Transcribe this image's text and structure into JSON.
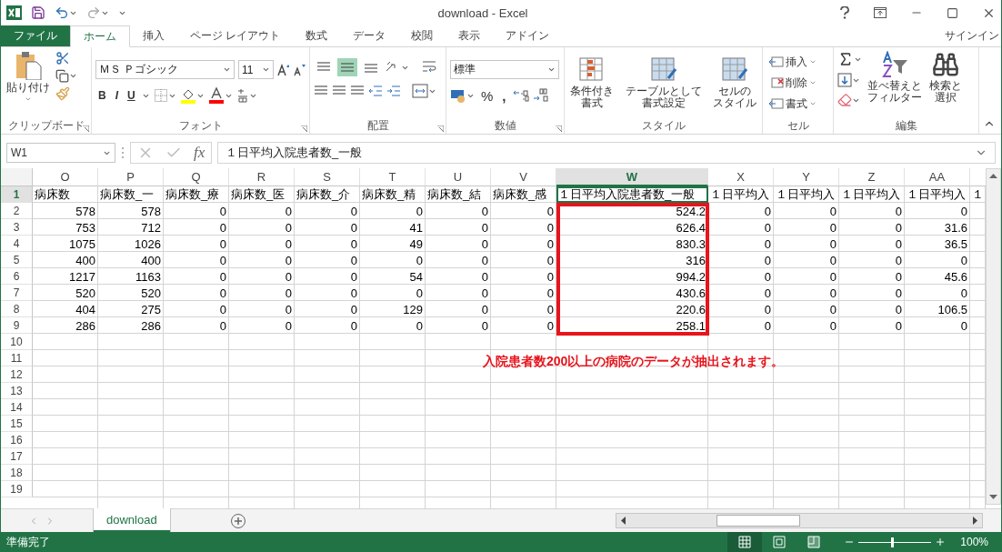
{
  "window": {
    "title": "download - Excel"
  },
  "tabs": [
    {
      "label": "ファイル",
      "kind": "file",
      "selected": false
    },
    {
      "label": "ホーム",
      "kind": "tab",
      "selected": true
    },
    {
      "label": "挿入",
      "kind": "tab",
      "selected": false
    },
    {
      "label": "ページ レイアウト",
      "kind": "tab",
      "selected": false
    },
    {
      "label": "数式",
      "kind": "tab",
      "selected": false
    },
    {
      "label": "データ",
      "kind": "tab",
      "selected": false
    },
    {
      "label": "校閲",
      "kind": "tab",
      "selected": false
    },
    {
      "label": "表示",
      "kind": "tab",
      "selected": false
    },
    {
      "label": "アドイン",
      "kind": "tab",
      "selected": false
    }
  ],
  "account": "サインイン",
  "ribbon": {
    "clipboard": {
      "name": "クリップボード",
      "paste": "貼り付け"
    },
    "font": {
      "name": "フォント",
      "font_name": "ＭＳ Ｐゴシック",
      "font_size": "11",
      "style_buttons": [
        "B",
        "I",
        "U"
      ]
    },
    "alignment": {
      "name": "配置",
      "vertical": [
        {
          "selected": false
        },
        {
          "selected": true
        },
        {
          "selected": false
        }
      ]
    },
    "number": {
      "name": "数値",
      "format": "標準",
      "buttons": [
        "%",
        ","
      ]
    },
    "styles": {
      "name": "スタイル",
      "buttons": [
        {
          "lines": [
            "条件付き",
            "書式"
          ]
        },
        {
          "lines": [
            "テーブルとして",
            "書式設定"
          ]
        },
        {
          "lines": [
            "セルの",
            "スタイル"
          ]
        }
      ]
    },
    "cells": {
      "name": "セル",
      "buttons": [
        "挿入",
        "削除",
        "書式"
      ]
    },
    "editing": {
      "name": "編集",
      "buttons": [
        {
          "lines": [
            "並べ替えと",
            "フィルター"
          ]
        },
        {
          "lines": [
            "検索と",
            "選択"
          ]
        }
      ]
    }
  },
  "formula_bar": {
    "name_box": "W1",
    "function_label": "fx",
    "value": "１日平均入院患者数_一般"
  },
  "columns": [
    {
      "label": "O",
      "selected": false
    },
    {
      "label": "P",
      "selected": false
    },
    {
      "label": "Q",
      "selected": false
    },
    {
      "label": "R",
      "selected": false
    },
    {
      "label": "S",
      "selected": false
    },
    {
      "label": "T",
      "selected": false
    },
    {
      "label": "U",
      "selected": false
    },
    {
      "label": "V",
      "selected": false
    },
    {
      "label": "W",
      "selected": true
    },
    {
      "label": "X",
      "selected": false
    },
    {
      "label": "Y",
      "selected": false
    },
    {
      "label": "Z",
      "selected": false
    },
    {
      "label": "AA",
      "selected": false
    }
  ],
  "rows": [
    {
      "number": "1",
      "selected": true,
      "kind": "header",
      "cells": [
        "病床数",
        "病床数_一",
        "病床数_療",
        "病床数_医",
        "病床数_介",
        "病床数_精",
        "病床数_結",
        "病床数_感",
        "１日平均入院患者数_一般",
        "１日平均入",
        "１日平均入",
        "１日平均入",
        "１日平均入",
        "１"
      ]
    },
    {
      "number": "2",
      "selected": false,
      "kind": "data",
      "cells": [
        "578",
        "578",
        "0",
        "0",
        "0",
        "0",
        "0",
        "0",
        "524.2",
        "0",
        "0",
        "0",
        "0"
      ]
    },
    {
      "number": "3",
      "selected": false,
      "kind": "data",
      "cells": [
        "753",
        "712",
        "0",
        "0",
        "0",
        "41",
        "0",
        "0",
        "626.4",
        "0",
        "0",
        "0",
        "31.6"
      ]
    },
    {
      "number": "4",
      "selected": false,
      "kind": "data",
      "cells": [
        "1075",
        "1026",
        "0",
        "0",
        "0",
        "49",
        "0",
        "0",
        "830.3",
        "0",
        "0",
        "0",
        "36.5"
      ]
    },
    {
      "number": "5",
      "selected": false,
      "kind": "data",
      "cells": [
        "400",
        "400",
        "0",
        "0",
        "0",
        "0",
        "0",
        "0",
        "316",
        "0",
        "0",
        "0",
        "0"
      ]
    },
    {
      "number": "6",
      "selected": false,
      "kind": "data",
      "cells": [
        "1217",
        "1163",
        "0",
        "0",
        "0",
        "54",
        "0",
        "0",
        "994.2",
        "0",
        "0",
        "0",
        "45.6"
      ]
    },
    {
      "number": "7",
      "selected": false,
      "kind": "data",
      "cells": [
        "520",
        "520",
        "0",
        "0",
        "0",
        "0",
        "0",
        "0",
        "430.6",
        "0",
        "0",
        "0",
        "0"
      ]
    },
    {
      "number": "8",
      "selected": false,
      "kind": "data",
      "cells": [
        "404",
        "275",
        "0",
        "0",
        "0",
        "129",
        "0",
        "0",
        "220.6",
        "0",
        "0",
        "0",
        "106.5"
      ]
    },
    {
      "number": "9",
      "selected": false,
      "kind": "data",
      "cells": [
        "286",
        "286",
        "0",
        "0",
        "0",
        "0",
        "0",
        "0",
        "258.1",
        "0",
        "0",
        "0",
        "0"
      ]
    },
    {
      "number": "10",
      "selected": false
    },
    {
      "number": "11",
      "selected": false
    },
    {
      "number": "12",
      "selected": false
    },
    {
      "number": "13",
      "selected": false
    },
    {
      "number": "14",
      "selected": false
    },
    {
      "number": "15",
      "selected": false
    },
    {
      "number": "16",
      "selected": false
    },
    {
      "number": "17",
      "selected": false
    },
    {
      "number": "18",
      "selected": false
    },
    {
      "number": "19",
      "selected": false
    }
  ],
  "annotation": {
    "text": "入院患者数200以上の病院のデータが抽出されます。"
  },
  "sheet_tabs": [
    {
      "label": "download",
      "selected": true
    }
  ],
  "status_bar": {
    "status": "準備完了",
    "views": [
      {
        "selected": true
      },
      {
        "selected": false
      },
      {
        "selected": false
      }
    ],
    "zoom": {
      "level": 0.45
    },
    "zoom_label": "100%"
  }
}
